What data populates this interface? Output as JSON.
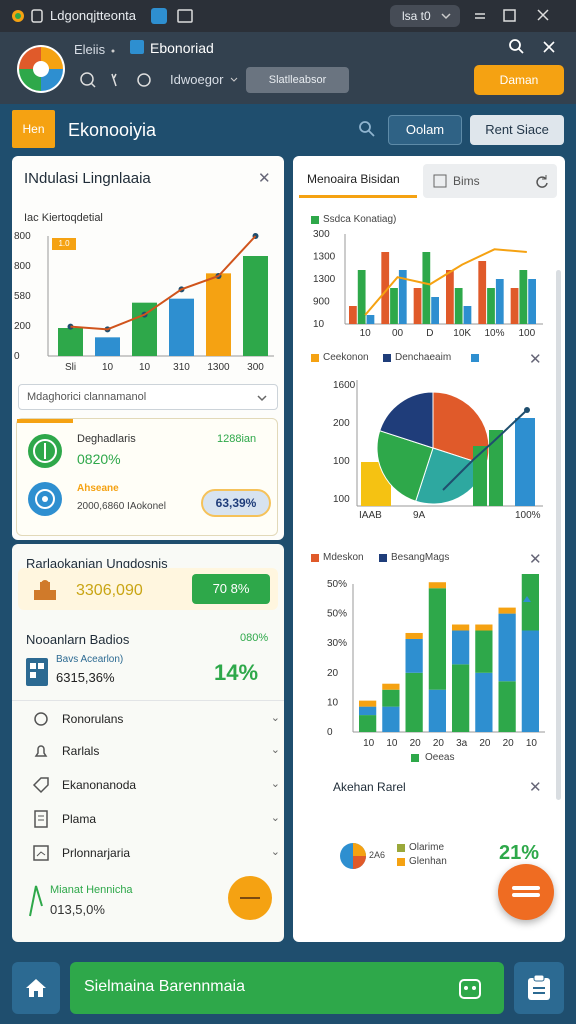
{
  "window": {
    "title": "Ldgonqjtteonta",
    "chip": "lsa t0"
  },
  "header": {
    "tab_label": "Eleiis",
    "doc_title": "Ebonoriad",
    "menu_label": "Idwoegor",
    "search_placeholder": "Slatlleabsor",
    "action_label": "Daman"
  },
  "nav": {
    "home_label": "Hen",
    "app_name": "Ekonooiyia",
    "btn_primary": "Oolam",
    "btn_secondary": "Rent Siace"
  },
  "card1": {
    "title": "INdulasi Lingnlaaia",
    "chart_label": "Iac Kiertoqdetial",
    "badge": "1.0",
    "dropdown": "Mdaghorici clannamanol",
    "stat1": {
      "label": "Deghadlaris",
      "value": "0820%",
      "aside": "1288ian"
    },
    "stat2": {
      "label": "Ahseane",
      "value": "2000,6860 IAokonel",
      "pill": "63,39%"
    }
  },
  "card2": {
    "title": "Rarlaokanian Ungdosnis",
    "value": "3306,090",
    "button": "70 8%",
    "section": "Nooanlarn Badios",
    "section_pct": "080%",
    "sub_label": "Bavs Acearlon)",
    "sub_value": "6315,36%",
    "big_pct": "14%",
    "rows": [
      "Ronorulans",
      "Rarlals",
      "Ekanonanoda",
      "Plama",
      "Prlonnarjaria"
    ],
    "footer_label": "Mianat Hennicha",
    "footer_value": "013,5,0%"
  },
  "card3": {
    "tab_active": "Menoaira Bisidan",
    "tab_inactive": "Bims",
    "chart1_legend": "Ssdca Konatiag)",
    "chart2_legend": [
      "Ceekonon",
      "Denchaeaim"
    ],
    "chart2_x": [
      "IAAB",
      "9A",
      "100%"
    ],
    "chart3_legend": [
      "Mdeskon",
      "BesangMags"
    ],
    "chart3_footer": "Oeeas",
    "section": "Akehan Rarel",
    "mini_pct": "2A6",
    "mini_legend": [
      "Olarime",
      "Glenhan"
    ],
    "big_pct": "21%"
  },
  "bottom": {
    "cta": "Sielmaina Barennmaia"
  },
  "colors": {
    "orange": "#f5a212",
    "green": "#2ea84a",
    "blue": "#2e8fd0",
    "navy": "#1f4e6e",
    "red": "#e05a2a"
  },
  "chart_data": [
    {
      "type": "bar",
      "title": "Iac Kiertoqdetial",
      "categories": [
        "Sli",
        "10",
        "10",
        "310",
        "1300",
        "300"
      ],
      "values": [
        210,
        140,
        400,
        430,
        620,
        750
      ],
      "line": [
        220,
        200,
        310,
        500,
        600,
        900
      ],
      "ylim": [
        0,
        900
      ],
      "y_ticks": [
        "0",
        "200",
        "580",
        "800",
        "800"
      ]
    },
    {
      "type": "bar",
      "title": "Ssdca Konatiag)",
      "categories": [
        "10",
        "00",
        "D",
        "10K",
        "10%",
        "100"
      ],
      "y_ticks": [
        "10",
        "900",
        "1300",
        "1300",
        "300"
      ],
      "series": [
        {
          "values": [
            20,
            80,
            40,
            60,
            70,
            40
          ]
        },
        {
          "values": [
            60,
            40,
            80,
            40,
            40,
            60
          ]
        },
        {
          "values": [
            10,
            60,
            30,
            20,
            50,
            50
          ]
        }
      ]
    },
    {
      "type": "bar",
      "title": "BesangMags",
      "categories": [
        "10",
        "10",
        "20",
        "20",
        "3a",
        "20",
        "20",
        "10"
      ],
      "y_ticks": [
        "0",
        "10",
        "20",
        "30%",
        "50%",
        "50%"
      ],
      "series": [
        {
          "values": [
            20,
            30,
            70,
            50,
            80,
            70,
            60,
            120
          ]
        },
        {
          "values": [
            10,
            20,
            40,
            120,
            40,
            50,
            80,
            100
          ]
        }
      ]
    },
    {
      "type": "pie",
      "title": "Denchaeaim",
      "y_ticks": [
        "100",
        "100",
        "200",
        "1600"
      ],
      "values": [
        30,
        25,
        25,
        20
      ]
    }
  ]
}
